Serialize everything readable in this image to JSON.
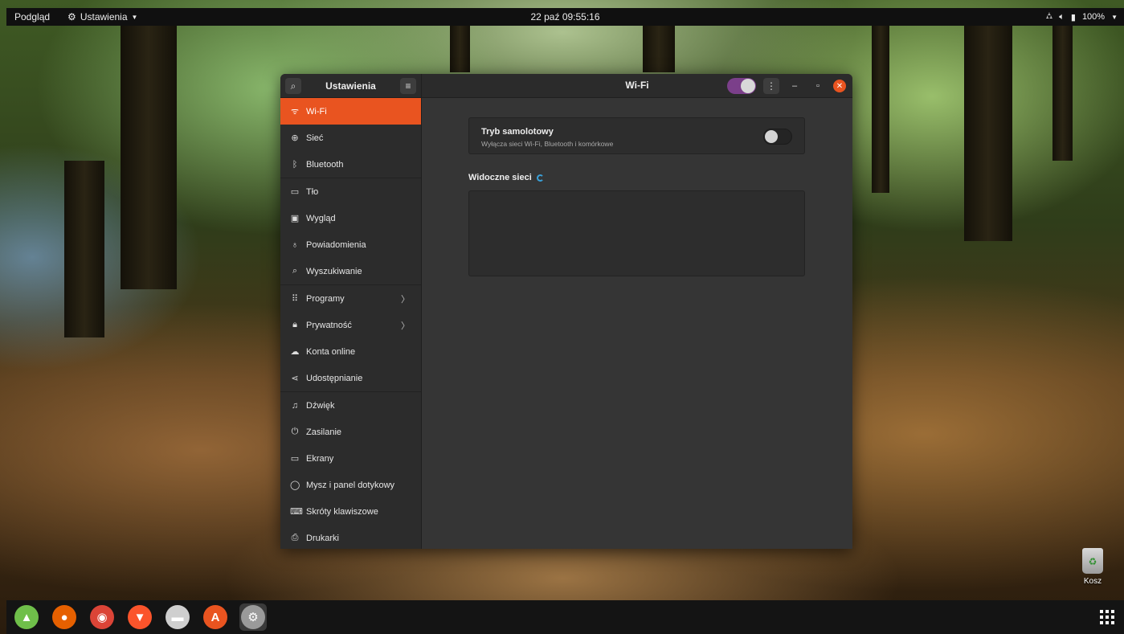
{
  "topbar": {
    "activities": "Podgląd",
    "app_menu_label": "Ustawienia",
    "app_menu_icon": "gear-icon",
    "clock": "22 paź  09:55:16",
    "battery_percent": "100%"
  },
  "window": {
    "sidebar_title": "Ustawienia",
    "page_title": "Wi-Fi",
    "wifi_toggle_on": true
  },
  "sidebar": {
    "items": [
      {
        "label": "Wi-Fi",
        "icon": "wifi-icon",
        "glyph": "ᯤ",
        "active": true,
        "chevron": false
      },
      {
        "label": "Sieć",
        "icon": "network-globe-icon",
        "glyph": "⊕",
        "active": false,
        "chevron": false
      },
      {
        "label": "Bluetooth",
        "icon": "bluetooth-icon",
        "glyph": "ᛒ",
        "active": false,
        "chevron": false
      },
      {
        "label": "Tło",
        "icon": "background-icon",
        "glyph": "▭",
        "active": false,
        "chevron": false
      },
      {
        "label": "Wygląd",
        "icon": "appearance-icon",
        "glyph": "▣",
        "active": false,
        "chevron": false
      },
      {
        "label": "Powiadomienia",
        "icon": "bell-icon",
        "glyph": "♁",
        "active": false,
        "chevron": false
      },
      {
        "label": "Wyszukiwanie",
        "icon": "search-icon",
        "glyph": "⌕",
        "active": false,
        "chevron": false
      },
      {
        "label": "Programy",
        "icon": "apps-icon",
        "glyph": "⠿",
        "active": false,
        "chevron": true
      },
      {
        "label": "Prywatność",
        "icon": "lock-icon",
        "glyph": "🔒︎",
        "active": false,
        "chevron": true
      },
      {
        "label": "Konta online",
        "icon": "cloud-icon",
        "glyph": "☁",
        "active": false,
        "chevron": false
      },
      {
        "label": "Udostępnianie",
        "icon": "share-icon",
        "glyph": "⋖",
        "active": false,
        "chevron": false
      },
      {
        "label": "Dźwięk",
        "icon": "music-note-icon",
        "glyph": "♫",
        "active": false,
        "chevron": false
      },
      {
        "label": "Zasilanie",
        "icon": "power-icon",
        "glyph": "⏻",
        "active": false,
        "chevron": false
      },
      {
        "label": "Ekrany",
        "icon": "display-icon",
        "glyph": "▭",
        "active": false,
        "chevron": false
      },
      {
        "label": "Mysz i panel dotykowy",
        "icon": "mouse-icon",
        "glyph": "◯",
        "active": false,
        "chevron": false
      },
      {
        "label": "Skróty klawiszowe",
        "icon": "keyboard-icon",
        "glyph": "⌨",
        "active": false,
        "chevron": false
      },
      {
        "label": "Drukarki",
        "icon": "printer-icon",
        "glyph": "⎙",
        "active": false,
        "chevron": false
      }
    ]
  },
  "content": {
    "airplane_title": "Tryb samolotowy",
    "airplane_subtitle": "Wyłącza sieci Wi-Fi, Bluetooth i komórkowe",
    "airplane_on": false,
    "visible_networks": "Widoczne sieci"
  },
  "dock": {
    "apps": [
      {
        "name": "android-studio-icon",
        "color": "#6fbf4a",
        "glyph": "▲"
      },
      {
        "name": "firefox-icon",
        "color": "#e66000",
        "glyph": "●"
      },
      {
        "name": "chrome-icon",
        "color": "#db4437",
        "glyph": "◉"
      },
      {
        "name": "brave-icon",
        "color": "#fb542b",
        "glyph": "▼"
      },
      {
        "name": "files-icon",
        "color": "#cfcfcf",
        "glyph": "▬"
      },
      {
        "name": "software-center-icon",
        "color": "#e95420",
        "glyph": "A"
      },
      {
        "name": "settings-icon",
        "color": "#9a9a9a",
        "glyph": "⚙"
      }
    ]
  },
  "desktop": {
    "trash_label": "Kosz"
  },
  "colors": {
    "accent": "#e95420",
    "toggle_purple": "#7b3f8a",
    "spinner_blue": "#3aa0d8"
  }
}
